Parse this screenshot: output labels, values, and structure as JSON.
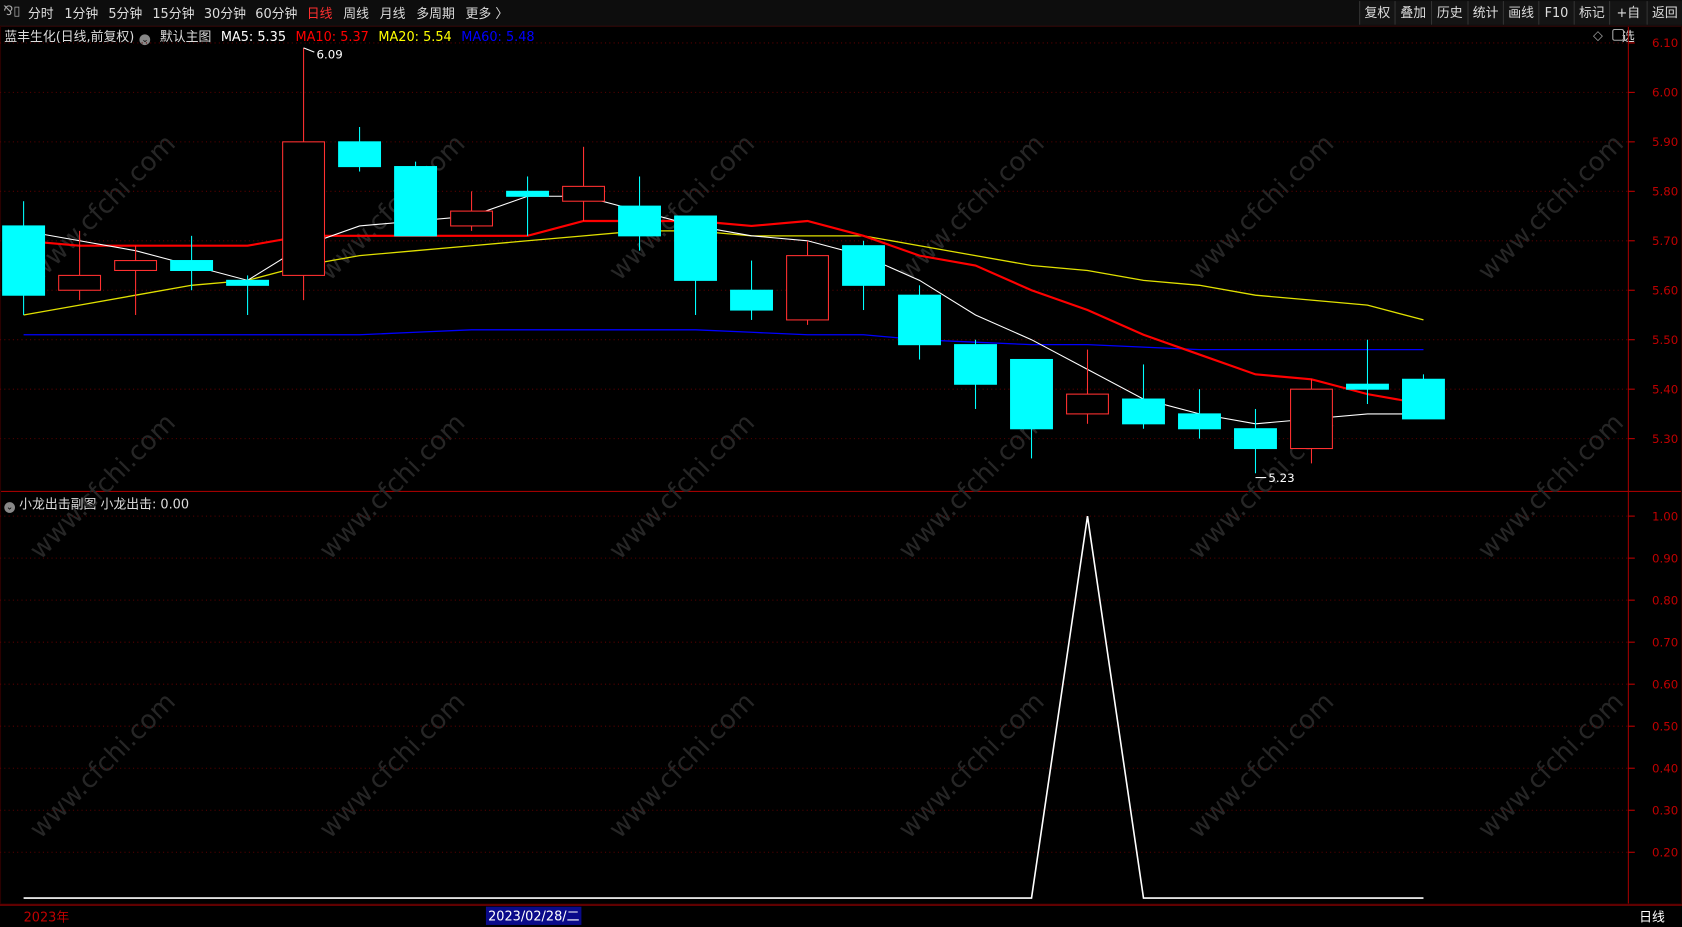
{
  "toolbar": {
    "collapse_icon": "collapse-icon",
    "periods": [
      "分时",
      "1分钟",
      "5分钟",
      "15分钟",
      "30分钟",
      "60分钟",
      "日线",
      "周线",
      "月线",
      "多周期",
      "更多 〉"
    ],
    "active_period": "日线",
    "right_buttons": [
      "复权",
      "叠加",
      "历史",
      "统计",
      "画线",
      "F10",
      "标记",
      "+自选",
      "返回"
    ]
  },
  "main": {
    "title": "蓝丰生化(日线,前复权)",
    "template": "默认主图",
    "ma5": "MA5: 5.35",
    "ma10": "MA10: 5.37",
    "ma20": "MA20: 5.54",
    "ma60": "MA60: 5.48",
    "high_label": "6.09",
    "low_label": "5.23",
    "diamond_icon": "diamond-icon",
    "panel_icon": "panel-toggle-icon"
  },
  "colors": {
    "up": "#ff3030",
    "down": "#00ffff",
    "ma5": "#ffffff",
    "ma10": "#ff0000",
    "ma20": "#e0e000",
    "ma60": "#0000ff",
    "axis": "#c00000"
  },
  "price_axis": [
    "6.10",
    "6.00",
    "5.90",
    "5.80",
    "5.70",
    "5.60",
    "5.50",
    "5.40",
    "5.30"
  ],
  "sub": {
    "title": "小龙出击副图",
    "value": "小龙出击: 0.00",
    "axis": [
      "1.00",
      "0.90",
      "0.80",
      "0.70",
      "0.60",
      "0.50",
      "0.40",
      "0.30",
      "0.20"
    ]
  },
  "bottom": {
    "year": "2023年",
    "cursor_date": "2023/02/28/二",
    "period": "日线"
  },
  "watermark": "www.cfchi.com",
  "chart_data": {
    "type": "candlestick",
    "ylim": [
      5.2,
      6.12
    ],
    "candles": [
      [
        5.73,
        5.59,
        5.78,
        5.55
      ],
      [
        5.6,
        5.63,
        5.72,
        5.58
      ],
      [
        5.64,
        5.66,
        5.69,
        5.55
      ],
      [
        5.66,
        5.64,
        5.71,
        5.6
      ],
      [
        5.62,
        5.61,
        5.63,
        5.55
      ],
      [
        5.63,
        5.9,
        6.09,
        5.58
      ],
      [
        5.9,
        5.85,
        5.93,
        5.84
      ],
      [
        5.85,
        5.71,
        5.86,
        5.71
      ],
      [
        5.73,
        5.76,
        5.8,
        5.72
      ],
      [
        5.8,
        5.79,
        5.83,
        5.71
      ],
      [
        5.78,
        5.81,
        5.89,
        5.74
      ],
      [
        5.77,
        5.71,
        5.83,
        5.68
      ],
      [
        5.75,
        5.62,
        5.75,
        5.55
      ],
      [
        5.6,
        5.56,
        5.66,
        5.54
      ],
      [
        5.54,
        5.67,
        5.7,
        5.53
      ],
      [
        5.69,
        5.61,
        5.7,
        5.56
      ],
      [
        5.59,
        5.49,
        5.61,
        5.46
      ],
      [
        5.49,
        5.41,
        5.5,
        5.36
      ],
      [
        5.46,
        5.32,
        5.46,
        5.26
      ],
      [
        5.35,
        5.39,
        5.48,
        5.33
      ],
      [
        5.38,
        5.33,
        5.45,
        5.32
      ],
      [
        5.35,
        5.32,
        5.4,
        5.3
      ],
      [
        5.32,
        5.28,
        5.36,
        5.23
      ],
      [
        5.28,
        5.4,
        5.42,
        5.25
      ],
      [
        5.41,
        5.4,
        5.5,
        5.37
      ],
      [
        5.42,
        5.34,
        5.43,
        5.34
      ]
    ],
    "candle_format": [
      "open",
      "close",
      "high",
      "low"
    ],
    "ma5": [
      5.72,
      5.7,
      5.68,
      5.65,
      5.62,
      5.69,
      5.73,
      5.74,
      5.75,
      5.79,
      5.79,
      5.76,
      5.73,
      5.71,
      5.7,
      5.67,
      5.62,
      5.55,
      5.5,
      5.44,
      5.38,
      5.35,
      5.33,
      5.34,
      5.35,
      5.35
    ],
    "ma10": [
      5.7,
      5.69,
      5.69,
      5.69,
      5.69,
      5.71,
      5.71,
      5.71,
      5.71,
      5.71,
      5.74,
      5.74,
      5.74,
      5.73,
      5.74,
      5.71,
      5.67,
      5.65,
      5.6,
      5.56,
      5.51,
      5.47,
      5.43,
      5.42,
      5.39,
      5.37
    ],
    "ma20": [
      5.55,
      5.57,
      5.59,
      5.61,
      5.62,
      5.65,
      5.67,
      5.68,
      5.69,
      5.7,
      5.71,
      5.72,
      5.72,
      5.71,
      5.71,
      5.71,
      5.69,
      5.67,
      5.65,
      5.64,
      5.62,
      5.61,
      5.59,
      5.58,
      5.57,
      5.54
    ],
    "ma60": [
      5.51,
      5.51,
      5.51,
      5.51,
      5.51,
      5.51,
      5.51,
      5.515,
      5.52,
      5.52,
      5.52,
      5.52,
      5.52,
      5.515,
      5.51,
      5.51,
      5.5,
      5.495,
      5.49,
      5.49,
      5.485,
      5.48,
      5.48,
      5.48,
      5.48,
      5.48
    ],
    "sub_series": [
      0,
      0,
      0,
      0,
      0,
      0,
      0,
      0,
      0,
      0,
      0,
      0,
      0,
      0,
      0,
      0,
      0,
      0,
      0,
      1,
      0,
      0,
      0,
      0,
      0,
      0
    ],
    "sub_ylim": [
      0.09,
      1.0
    ]
  }
}
